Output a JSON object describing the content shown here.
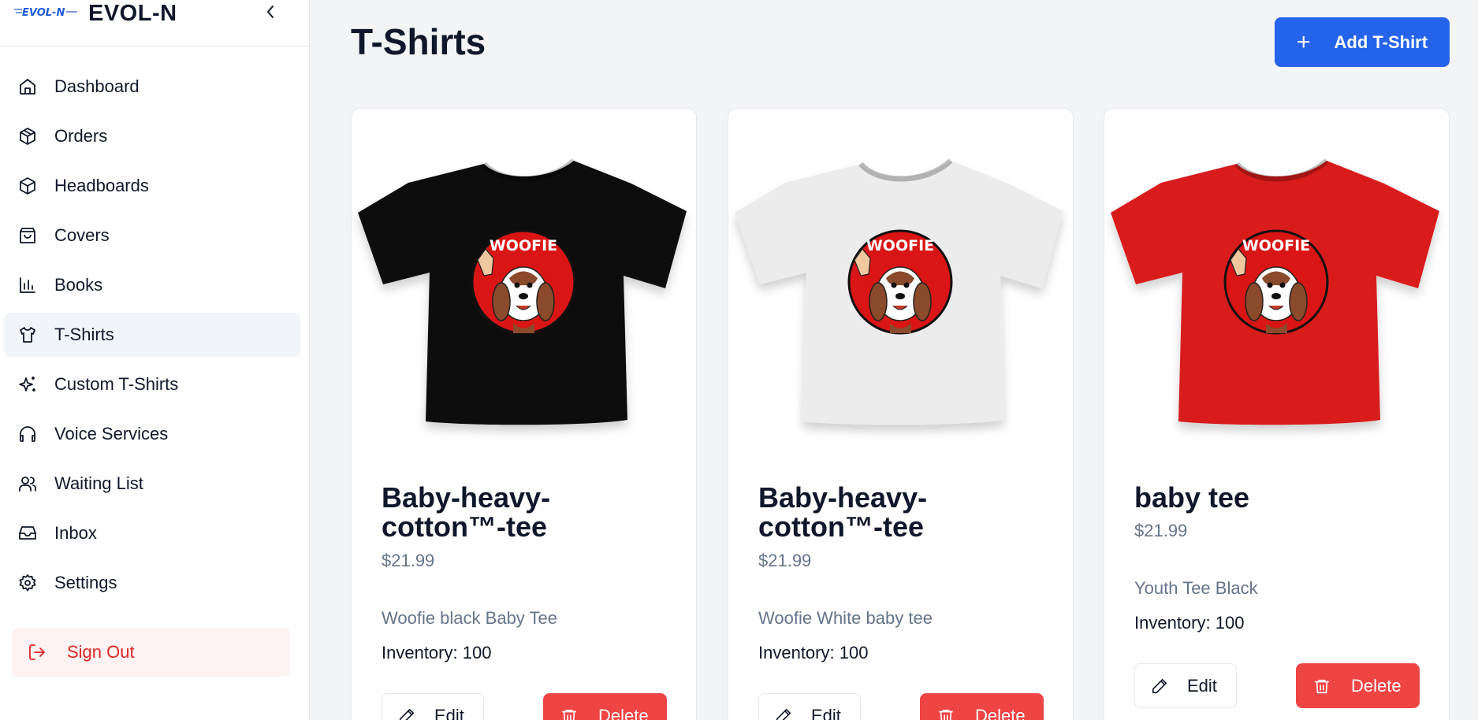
{
  "brand": {
    "logo_text": "EVOL-N",
    "name": "EVOL-N"
  },
  "sidebar": {
    "items": [
      {
        "label": "Dashboard",
        "icon": "home-icon"
      },
      {
        "label": "Orders",
        "icon": "package-icon"
      },
      {
        "label": "Headboards",
        "icon": "box-icon"
      },
      {
        "label": "Covers",
        "icon": "shopping-bag-icon"
      },
      {
        "label": "Books",
        "icon": "bar-chart-icon"
      },
      {
        "label": "T-Shirts",
        "icon": "shirt-icon",
        "active": true
      },
      {
        "label": "Custom T-Shirts",
        "icon": "sparkles-icon"
      },
      {
        "label": "Voice Services",
        "icon": "headphones-icon"
      },
      {
        "label": "Waiting List",
        "icon": "users-icon"
      },
      {
        "label": "Inbox",
        "icon": "inbox-icon"
      },
      {
        "label": "Settings",
        "icon": "gear-icon"
      }
    ],
    "signout_label": "Sign Out"
  },
  "main": {
    "title": "T-Shirts",
    "add_button_label": "Add T-Shirt"
  },
  "products": [
    {
      "title": "Baby-heavy-cotton™-tee",
      "price": "$21.99",
      "description": "Woofie black Baby Tee",
      "inventory": "Inventory: 100",
      "shirt_color": "#111111",
      "logo_text": "WOOFIE",
      "edit_label": "Edit",
      "delete_label": "Delete"
    },
    {
      "title": "Baby-heavy-cotton™-tee",
      "price": "$21.99",
      "description": "Woofie White baby tee",
      "inventory": "Inventory: 100",
      "shirt_color": "#ececec",
      "logo_text": "WOOFIE",
      "edit_label": "Edit",
      "delete_label": "Delete"
    },
    {
      "title": "baby tee",
      "price": "$21.99",
      "description": "Youth Tee Black",
      "inventory": "Inventory: 100",
      "shirt_color": "#d81a1a",
      "logo_text": "WOOFIE",
      "edit_label": "Edit",
      "delete_label": "Delete"
    }
  ],
  "colors": {
    "accent": "#2563eb",
    "danger": "#ef4444",
    "muted_text": "#64748b"
  }
}
